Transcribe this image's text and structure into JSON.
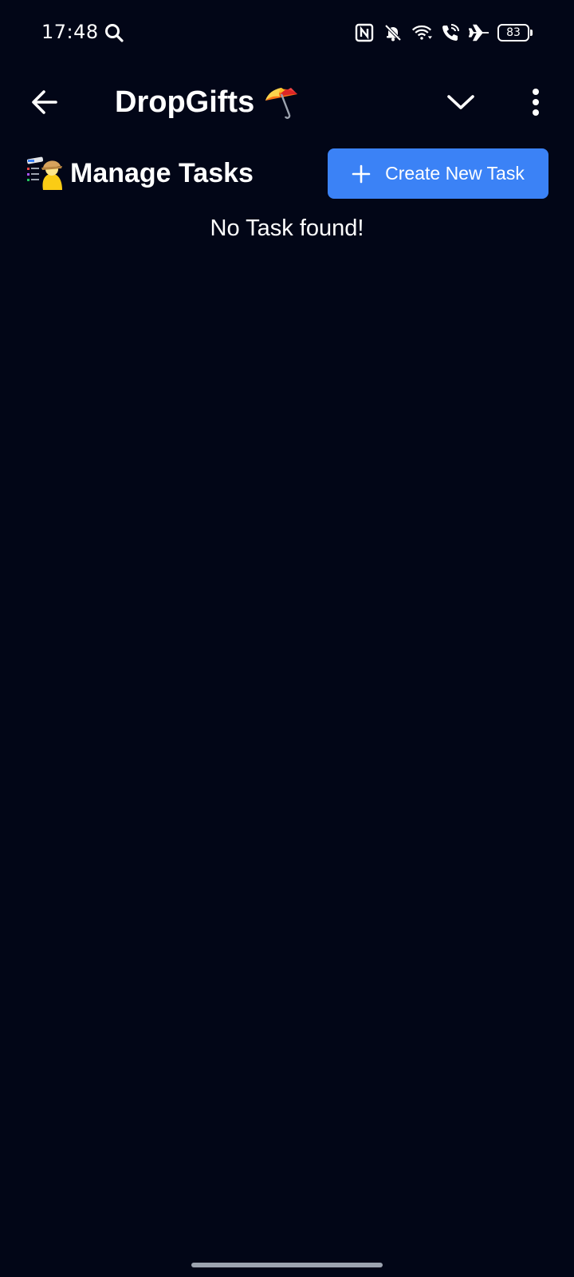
{
  "status_bar": {
    "time": "17:48",
    "battery": "83",
    "icons": [
      "search-icon",
      "nfc-icon",
      "bell-off-icon",
      "wifi-icon",
      "wifi-calling-icon",
      "airplane-icon",
      "battery-icon"
    ]
  },
  "app_bar": {
    "title": "DropGifts",
    "title_icon": "umbrella-icon",
    "back_icon": "arrow-left-icon",
    "dropdown_icon": "chevron-down-icon",
    "menu_icon": "more-vertical-icon"
  },
  "tasks": {
    "title": "Manage Tasks",
    "title_icon": "task-list-person-icon",
    "create_button_label": "Create New Task",
    "create_button_icon": "plus-icon",
    "empty_message": "No Task found!"
  },
  "colors": {
    "background": "#020617",
    "accent": "#3b82f6",
    "text": "#ffffff"
  }
}
